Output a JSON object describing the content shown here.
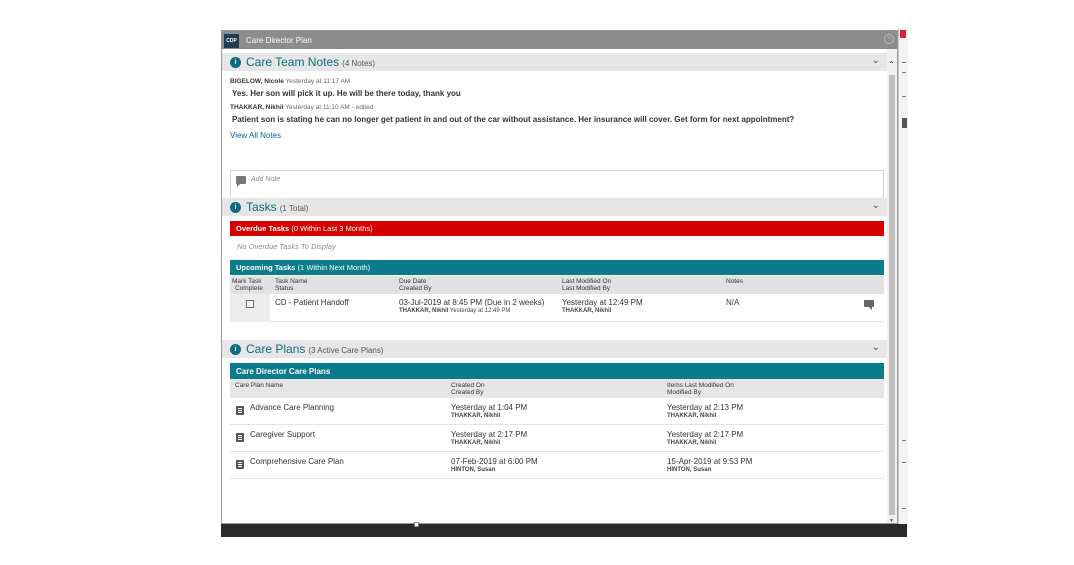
{
  "window": {
    "app_logo": "CDP",
    "title": "Care Director Plan",
    "close_icon": "close-circle-icon"
  },
  "care_team_notes": {
    "title": "Care Team Notes",
    "count": "(4 Notes)",
    "notes": [
      {
        "author": "BIGELOW, Nicole",
        "time": "Yesterday at 11:17 AM",
        "text": "Yes. Her son will pick it up. He will be there today, thank you"
      },
      {
        "author": "THAKKAR, Nikhil",
        "time": "Yesterday at 11:10 AM - edited",
        "text": "Patient son is stating he can no longer get patient in and out of the car without assistance. Her insurance will cover. Get form for next appointment?"
      }
    ],
    "view_all": "View All Notes",
    "add_note_placeholder": "Add Note"
  },
  "tasks": {
    "title": "Tasks",
    "count": "(1 Total)",
    "overdue": {
      "label": "Overdue Tasks",
      "detail": "(0 Within Last 3 Months)",
      "empty": "No Overdue Tasks To Display"
    },
    "upcoming": {
      "label": "Upcoming Tasks",
      "detail": "(1 Within Next Month)"
    },
    "columns": {
      "mark_1": "Mark Task",
      "mark_2": "Complete",
      "name_1": "Task Name",
      "name_2": "Status",
      "due_1": "Due Date",
      "due_2": "Created By",
      "modified_1": "Last Modified On",
      "modified_2": "Last Modified By",
      "notes": "Notes"
    },
    "rows": [
      {
        "name": "CD - Patient Handoff",
        "due": "03-Jul-2019 at 8:45 PM (Due in 2 weeks)",
        "created_by": "THAKKAR, Nikhil",
        "created_time": "Yesterday at 12:49 PM",
        "modified": "Yesterday at 12:49 PM",
        "modified_by": "THAKKAR, Nikhil",
        "notes": "N/A"
      }
    ]
  },
  "care_plans": {
    "title": "Care Plans",
    "count": "(3 Active Care Plans)",
    "group_label": "Care Director Care Plans",
    "columns": {
      "name": "Care Plan Name",
      "created_1": "Created On",
      "created_2": "Created By",
      "modified_1": "Items Last Modified On",
      "modified_2": "Modified By"
    },
    "rows": [
      {
        "name": "Advance Care Planning",
        "created_on": "Yesterday at 1:04 PM",
        "created_by": "THAKKAR, Nikhil",
        "modified_on": "Yesterday at 2:13 PM",
        "modified_by": "THAKKAR, Nikhil"
      },
      {
        "name": "Caregiver Support",
        "created_on": "Yesterday at 2:17 PM",
        "created_by": "THAKKAR, Nikhil",
        "modified_on": "Yesterday at 2:17 PM",
        "modified_by": "THAKKAR, Nikhil"
      },
      {
        "name": "Comprehensive Care Plan",
        "created_on": "07-Feb-2019 at 6:00 PM",
        "created_by": "HINTON, Susan",
        "modified_on": "15-Apr-2019 at 9:53 PM",
        "modified_by": "HINTON, Susan"
      }
    ]
  },
  "icons": {
    "section": "info-circle-icon",
    "collapse": "chevron-down-icon",
    "note": "comment-icon",
    "plan": "document-icon"
  },
  "colors": {
    "accent": "#0b6c80",
    "teal_bar": "#0b7c8b",
    "overdue_red": "#d50000",
    "title_bar": "#8c8c8c"
  }
}
